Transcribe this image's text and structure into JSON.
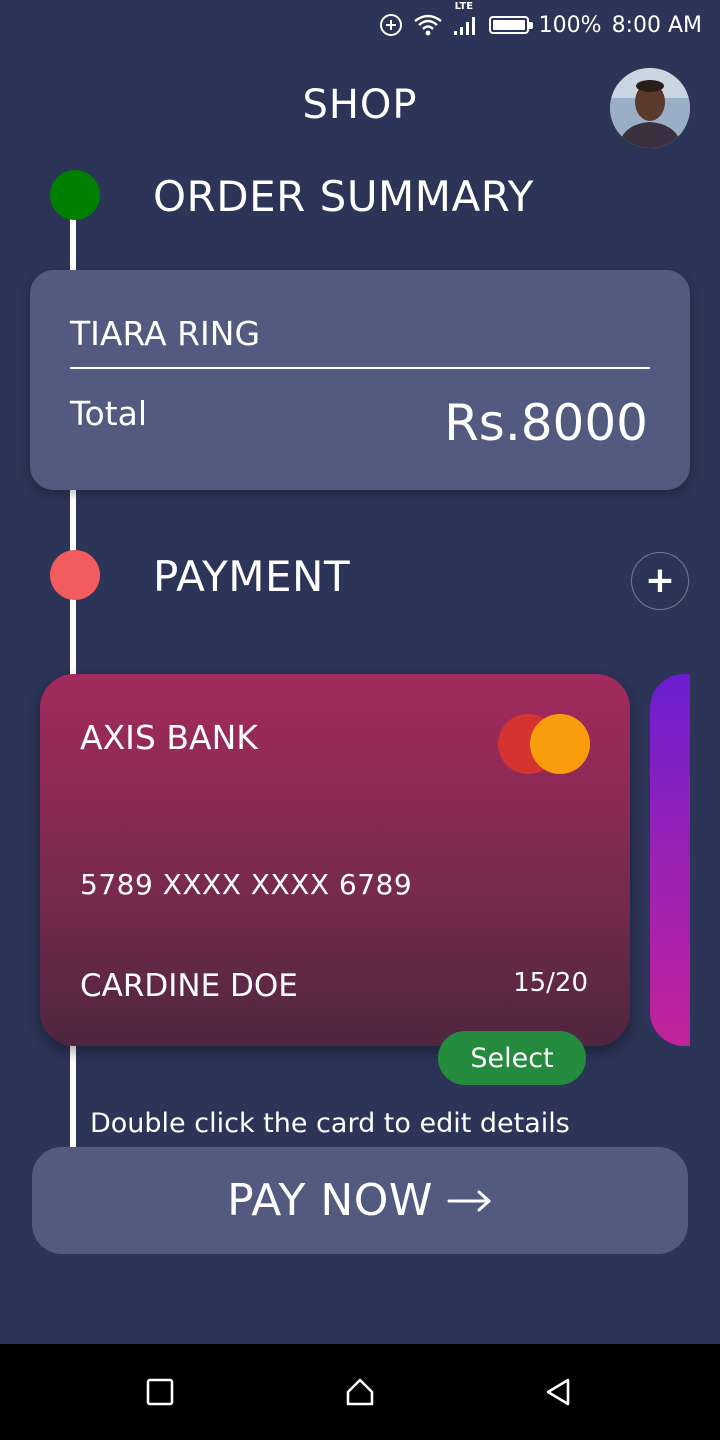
{
  "status_bar": {
    "battery_percent": "100%",
    "time": "8:00 AM",
    "network_label": "LTE",
    "icons": [
      "add-circle-icon",
      "wifi-icon",
      "signal-icon",
      "battery-icon"
    ]
  },
  "header": {
    "title": "SHOP",
    "avatar_icon": "user-avatar"
  },
  "order_summary": {
    "title": "ORDER SUMMARY",
    "status_color": "#008000",
    "item_name": "TIARA RING",
    "total_label": "Total",
    "total_value": "Rs.8000"
  },
  "payment": {
    "title": "PAYMENT",
    "status_color": "#f25c5c",
    "add_icon": "plus-icon",
    "card": {
      "bank": "AXIS BANK",
      "number": "5789 XXXX XXXX 6789",
      "holder": "CARDINE DOE",
      "expiry": "15/20",
      "brand_icon": "mastercard-icon"
    },
    "select_label": "Select",
    "hint": "Double click the card to edit details"
  },
  "pay_button": {
    "label": "PAY NOW",
    "icon": "arrow-right-icon"
  },
  "nav_bar": {
    "icons": [
      "recents-icon",
      "home-icon",
      "back-icon"
    ]
  },
  "colors": {
    "background": "#2c3457",
    "card_surface": "#525a80",
    "select_button": "#238a3e",
    "mastercard_red": "#d53232",
    "mastercard_orange": "#f99c0b"
  }
}
